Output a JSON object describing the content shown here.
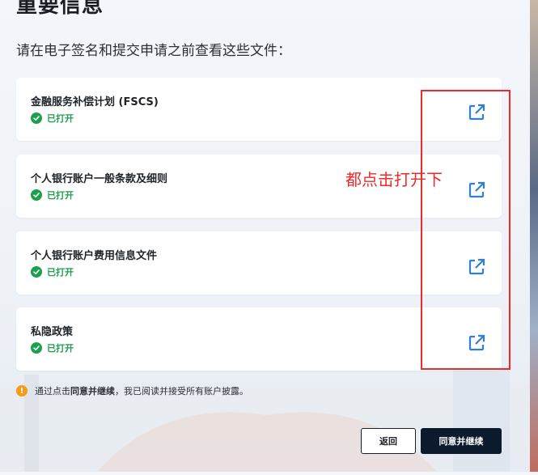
{
  "page": {
    "title": "重要信息",
    "subtitle": "请在电子签名和提交申请之前查看这些文件："
  },
  "documents": [
    {
      "name": "金融服务补偿计划 (FSCS)",
      "status": "已打开",
      "icon": "external-link-icon"
    },
    {
      "name": "个人银行账户一般条款及细则",
      "status": "已打开",
      "icon": "external-link-icon"
    },
    {
      "name": "个人银行账户费用信息文件",
      "status": "已打开",
      "icon": "external-link-icon"
    },
    {
      "name": "私隐政策",
      "status": "已打开",
      "icon": "external-link-icon"
    }
  ],
  "annotation": {
    "text": "都点击打开下",
    "color": "#ef2a2a"
  },
  "notice": {
    "prefix": "通过点击",
    "bold": "同意并继续",
    "suffix": "，我已阅读并接受所有账户披露。"
  },
  "buttons": {
    "back_label": "返回",
    "agree_label": "同意并继续"
  },
  "colors": {
    "status_green": "#1e9e4f",
    "primary_button": "#0b1a2c",
    "link_icon_blue": "#2f7fd8",
    "warning_orange": "#f59c1a"
  }
}
